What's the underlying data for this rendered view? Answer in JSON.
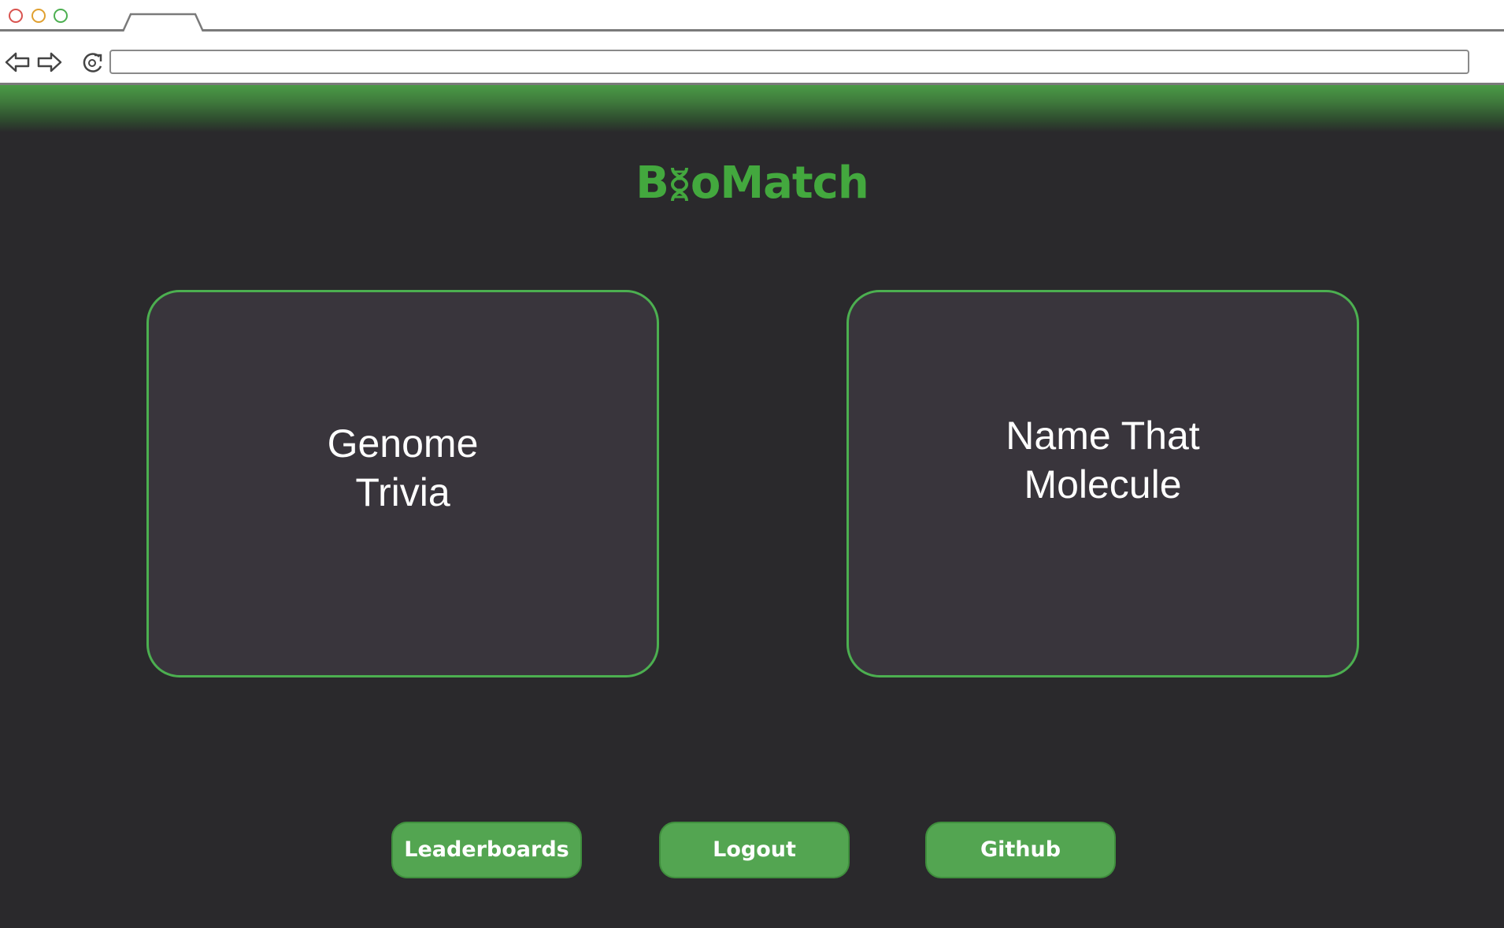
{
  "browser": {
    "url": ""
  },
  "app": {
    "logo_prefix": "B",
    "logo_suffix": "oMatch"
  },
  "games": [
    {
      "title_line1": "Genome",
      "title_line2": "Trivia"
    },
    {
      "title_line1": "Name That",
      "title_line2": "Molecule"
    }
  ],
  "footer": {
    "leaderboards_label": "Leaderboards",
    "logout_label": "Logout",
    "github_label": "Github"
  },
  "colors": {
    "accent": "#4caf50",
    "button": "#53a551",
    "background": "#2a292c",
    "card": "#39353c",
    "logo": "#43a83e"
  }
}
